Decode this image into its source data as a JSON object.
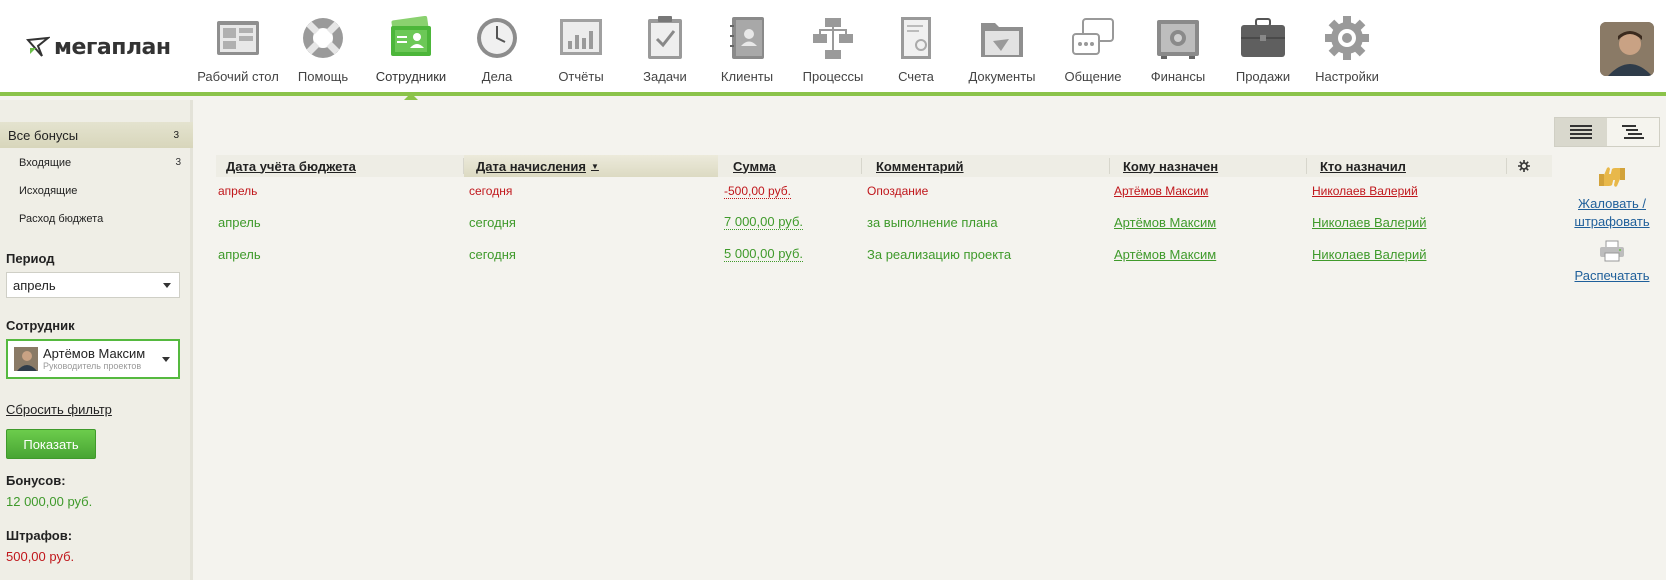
{
  "app": {
    "logo_text": "мегаплан"
  },
  "nav": {
    "items": [
      {
        "label": "Рабочий стол",
        "icon": "desktop-icon"
      },
      {
        "label": "Помощь",
        "icon": "lifebuoy-icon"
      },
      {
        "label": "Сотрудники",
        "icon": "employees-icon",
        "active": true
      },
      {
        "label": "Дела",
        "icon": "clock-icon"
      },
      {
        "label": "Отчёты",
        "icon": "reports-icon"
      },
      {
        "label": "Задачи",
        "icon": "tasks-icon"
      },
      {
        "label": "Клиенты",
        "icon": "clients-icon"
      },
      {
        "label": "Процессы",
        "icon": "processes-icon"
      },
      {
        "label": "Счета",
        "icon": "invoices-icon"
      },
      {
        "label": "Документы",
        "icon": "documents-icon"
      },
      {
        "label": "Общение",
        "icon": "chat-icon"
      },
      {
        "label": "Финансы",
        "icon": "safe-icon"
      },
      {
        "label": "Продажи",
        "icon": "briefcase-icon"
      },
      {
        "label": "Настройки",
        "icon": "gear-icon"
      }
    ]
  },
  "sidebar": {
    "all_bonuses": {
      "label": "Все бонусы",
      "count": "3"
    },
    "incoming": {
      "label": "Входящие",
      "count": "3"
    },
    "outgoing": {
      "label": "Исходящие"
    },
    "budget": {
      "label": "Расход бюджета"
    },
    "period_label": "Период",
    "period_value": "апрель",
    "employee_label": "Сотрудник",
    "employee_name": "Артёмов Максим",
    "employee_role": "Руководитель проектов",
    "reset_label": "Сбросить фильтр",
    "show_label": "Показать",
    "bonuses_label": "Бонусов:",
    "bonuses_value": "12 000,00 руб.",
    "fines_label": "Штрафов:",
    "fines_value": "500,00 руб."
  },
  "table": {
    "headers": {
      "budget_date": "Дата учёта бюджета",
      "accrual_date": "Дата начисления",
      "sum": "Сумма",
      "comment": "Комментарий",
      "assigned_to": "Кому назначен",
      "assigned_by": "Кто назначил"
    },
    "rows": [
      {
        "budget_date": "апрель",
        "accrual_date": "сегодня",
        "sum": "-500,00 руб.",
        "comment": "Опоздание",
        "assigned_to": "Артёмов Максим",
        "assigned_by": "Николаев Валерий"
      },
      {
        "budget_date": "апрель",
        "accrual_date": "сегодня",
        "sum": "7 000,00 руб.",
        "comment": "за выполнение плана",
        "assigned_to": "Артёмов Максим",
        "assigned_by": "Николаев Валерий"
      },
      {
        "budget_date": "апрель",
        "accrual_date": "сегодня",
        "sum": "5 000,00 руб.",
        "comment": "За реализацию проекта",
        "assigned_to": "Артёмов Максим",
        "assigned_by": "Николаев Валерий"
      }
    ]
  },
  "actions": {
    "reward_line1": "Жаловать /",
    "reward_line2": "штрафовать",
    "print": "Распечатать"
  },
  "colors": {
    "accent": "#8bc34a",
    "positive": "#3f9a2b",
    "negative": "#c0161b",
    "link": "#1f5f9a"
  }
}
